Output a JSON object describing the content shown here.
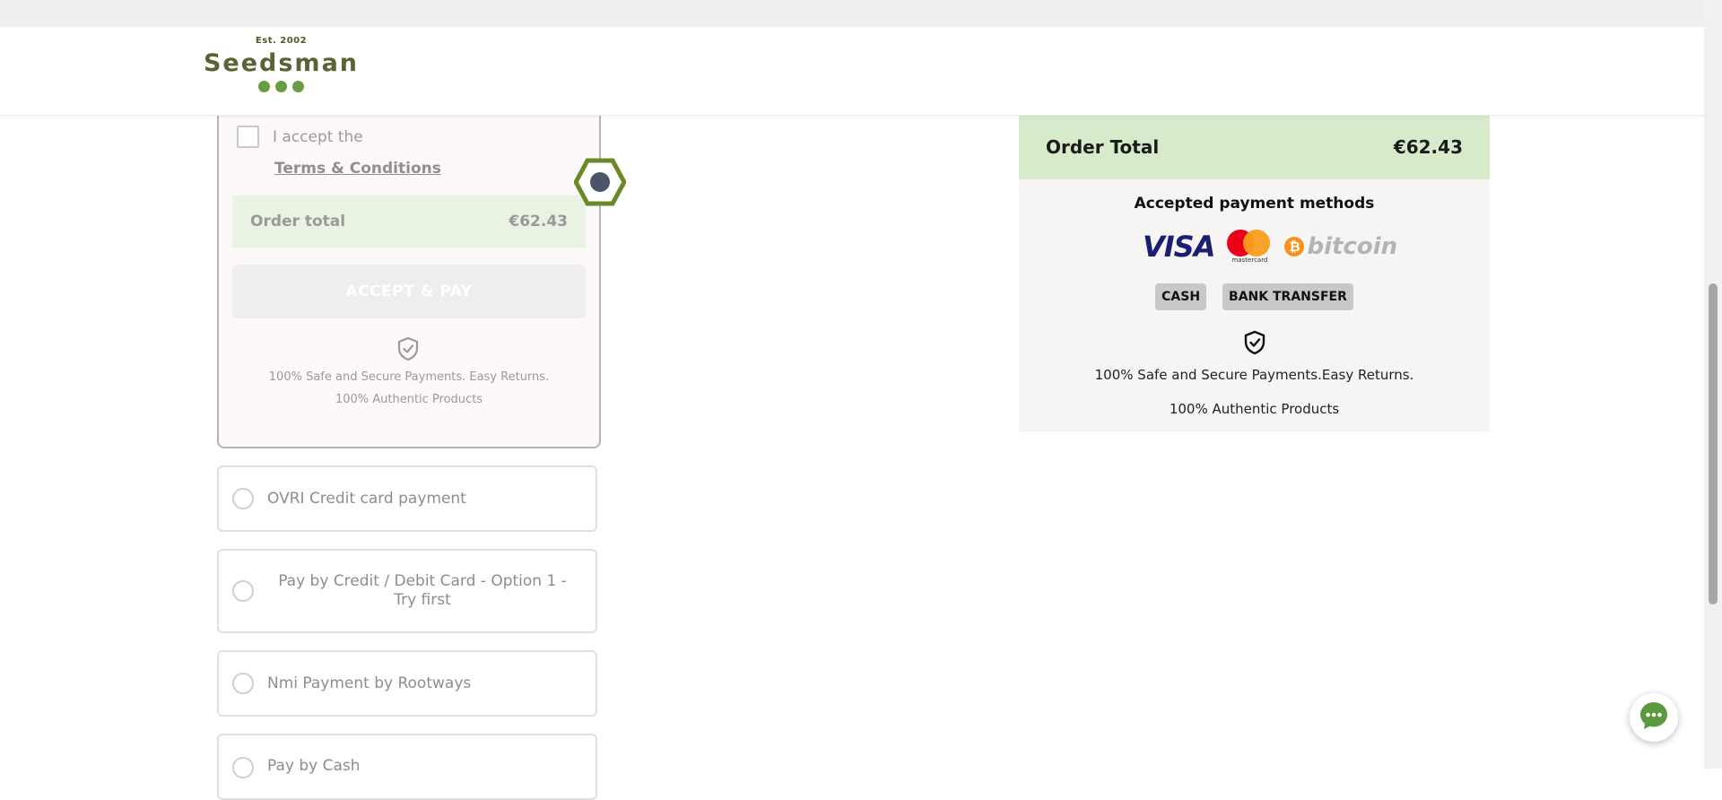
{
  "header": {
    "logo_est": "Est. 2002",
    "logo_brand": "Seedsman"
  },
  "checkout": {
    "accept_text": "I accept the",
    "terms_link": "Terms & Conditions",
    "order_total_label": "Order total",
    "order_total_value": "€62.43",
    "accept_pay_label": "ACCEPT & PAY",
    "secure_line1": "100% Safe and Secure Payments. Easy Returns.",
    "secure_line2": "100% Authentic Products"
  },
  "payment_options": [
    {
      "label": "OVRI Credit card payment"
    },
    {
      "label": "Pay by Credit / Debit Card - Option 1 - Try first"
    },
    {
      "label": "Nmi Payment by Rootways"
    },
    {
      "label": "Pay by Cash"
    }
  ],
  "summary": {
    "order_total_label": "Order Total",
    "order_total_value": "€62.43",
    "payments_title": "Accepted payment methods",
    "visa_label": "VISA",
    "mastercard_label": "mastercard",
    "bitcoin_label": "bitcoin",
    "tags": [
      "CASH",
      "BANK TRANSFER"
    ],
    "secure_line1": "100% Safe and Secure Payments.Easy Returns.",
    "secure_line2": "100% Authentic Products"
  },
  "colors": {
    "brand_green": "#6a9c43",
    "summary_total_bg": "#d7ebcb",
    "checkout_total_bg": "#e9f3e3"
  },
  "icons": [
    "shield-check-icon",
    "chat-icon",
    "cursor-marker-icon"
  ]
}
